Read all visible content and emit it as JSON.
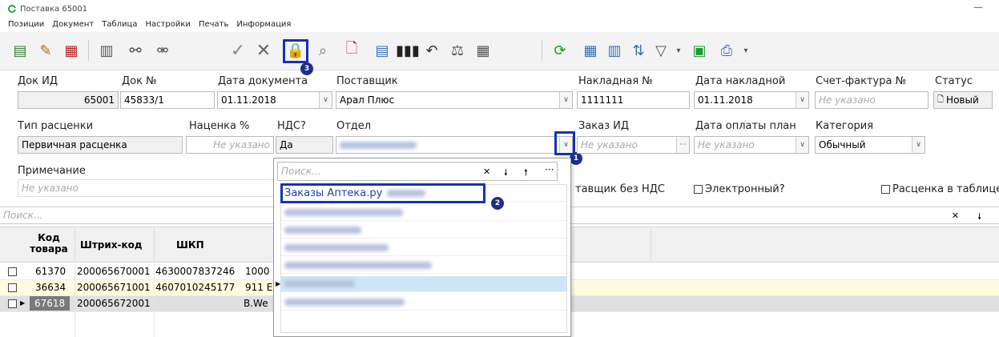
{
  "window": {
    "title": "Поставка 65001",
    "minimize": "—"
  },
  "menu": [
    "Позиции",
    "Документ",
    "Таблица",
    "Настройки",
    "Печать",
    "Информация"
  ],
  "toolbar": {
    "badge3": "3"
  },
  "fields": {
    "doc_id_label": "Док ИД",
    "doc_id_value": "65001",
    "doc_no_label": "Док №",
    "doc_no_value": "45833/1",
    "doc_date_label": "Дата документа",
    "doc_date_value": "01.11.2018",
    "supplier_label": "Поставщик",
    "supplier_value": "Арал Плюс",
    "invoice_no_label": "Накладная №",
    "invoice_no_value": "1111111",
    "invoice_date_label": "Дата накладной",
    "invoice_date_value": "01.11.2018",
    "invoice_fact_label": "Счет-фактура №",
    "invoice_fact_placeholder": "Не указано",
    "status_label": "Статус",
    "status_value": "Новый",
    "pricing_type_label": "Тип расценки",
    "pricing_type_value": "Первичная расценка",
    "markup_label": "Наценка %",
    "markup_placeholder": "Не указано",
    "vat_label": "НДС?",
    "vat_value": "Да",
    "department_label": "Отдел",
    "order_id_label": "Заказ ИД",
    "order_id_placeholder": "Не указано",
    "pay_date_label": "Дата оплаты план",
    "pay_date_placeholder": "Не указано",
    "category_label": "Категория",
    "category_value": "Обычный",
    "note_label": "Примечание",
    "note_placeholder": "Не указано",
    "supplier_no_vat_label": "тавщик без НДС",
    "electronic_label": "Электронный?",
    "pricing_in_table_label": "Расценка в таблице"
  },
  "grid": {
    "search_placeholder": "Поиск...",
    "headers": {
      "code": "Код товара",
      "barcode": "Штрих-код",
      "shkp": "ШКП"
    },
    "rows": [
      {
        "code": "61370",
        "barcode": "200065670001",
        "shkp": "4630007837246",
        "extra": "1000"
      },
      {
        "code": "36634",
        "barcode": "200065671001",
        "shkp": "4607010245177",
        "extra": "911 E"
      },
      {
        "code": "67618",
        "barcode": "200065672001",
        "shkp": "",
        "extra": "B.We"
      }
    ]
  },
  "popup": {
    "search_placeholder": "Поиск...",
    "first_item": "Заказы Аптека.ру",
    "badge1": "1",
    "badge2": "2"
  },
  "colors": {
    "highlight": "#1431b8",
    "badge": "#1e2f88",
    "selected_row": "#cde6f7",
    "yellow_row": "#fffbe0"
  }
}
